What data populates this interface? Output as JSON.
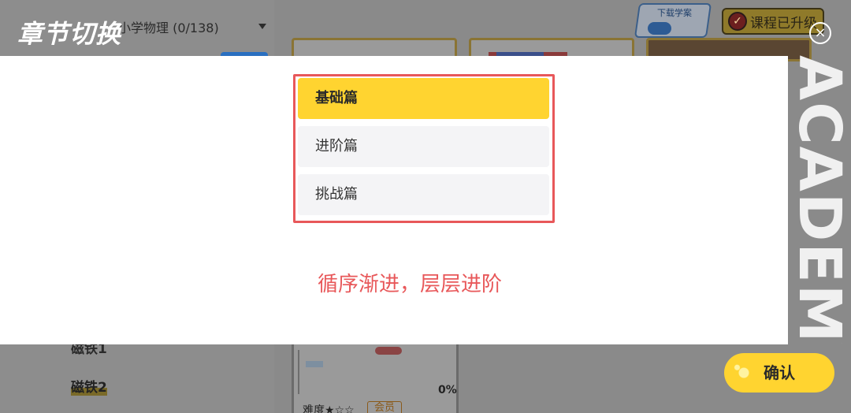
{
  "background": {
    "subject_select": "小学物理 (0/138)",
    "download_label": "下载学案",
    "upgrade_label": "课程已升级",
    "lessons": [
      "磁铁1",
      "磁铁2"
    ],
    "progress_text": "0%",
    "difficulty_text": "难度★☆☆",
    "member_tag": "会员",
    "watermark": "ACADEMY"
  },
  "dialog": {
    "title": "章节切换",
    "close_icon": "×",
    "chapters": [
      {
        "label": "基础篇",
        "selected": true
      },
      {
        "label": "进阶篇",
        "selected": false
      },
      {
        "label": "挑战篇",
        "selected": false
      }
    ],
    "caption": "循序渐进，层层进阶",
    "confirm_label": "确认"
  },
  "colors": {
    "accent_yellow": "#ffd430",
    "highlight_red": "#e8585a",
    "overlay_dim": "#8a8a8a"
  }
}
